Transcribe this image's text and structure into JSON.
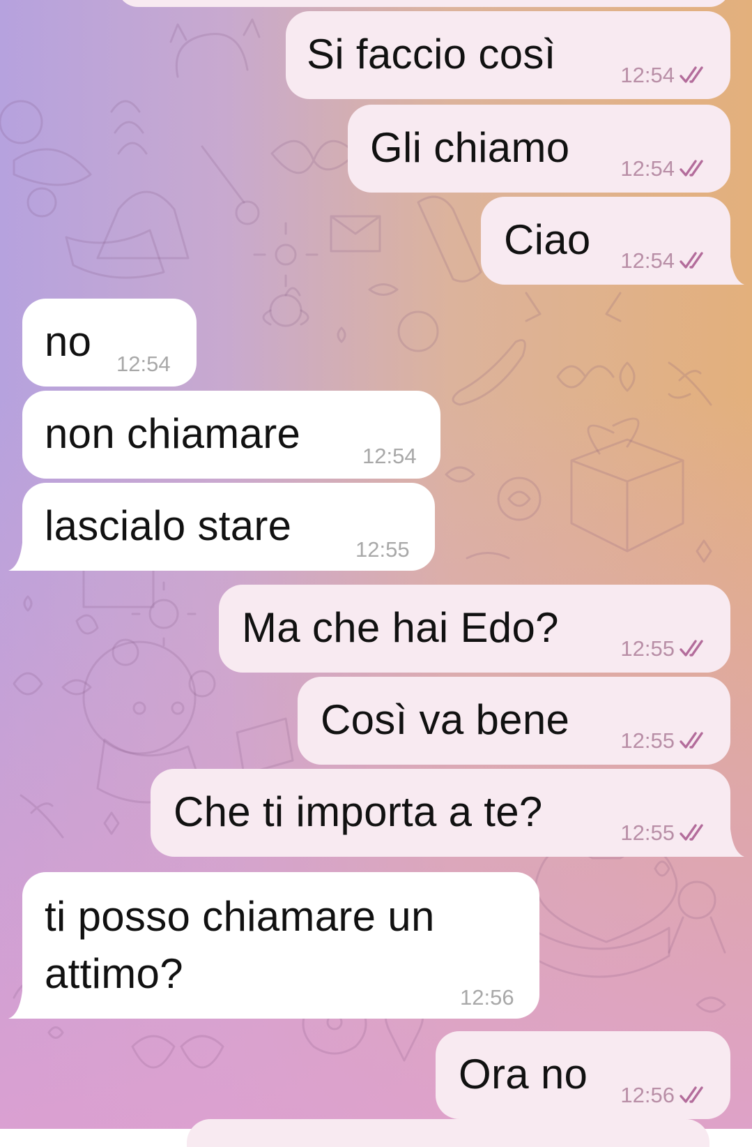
{
  "chat": {
    "messages": [
      {
        "id": "m1",
        "direction": "outgoing",
        "text": "Si faccio così",
        "time": "12:54",
        "status": "read"
      },
      {
        "id": "m2",
        "direction": "outgoing",
        "text": "Gli chiamo",
        "time": "12:54",
        "status": "read"
      },
      {
        "id": "m3",
        "direction": "outgoing",
        "text": "Ciao",
        "time": "12:54",
        "status": "read"
      },
      {
        "id": "m4",
        "direction": "incoming",
        "text": "no",
        "time": "12:54"
      },
      {
        "id": "m5",
        "direction": "incoming",
        "text": "non chiamare",
        "time": "12:54"
      },
      {
        "id": "m6",
        "direction": "incoming",
        "text": "lascialo stare",
        "time": "12:55"
      },
      {
        "id": "m7",
        "direction": "outgoing",
        "text": "Ma che hai Edo?",
        "time": "12:55",
        "status": "read"
      },
      {
        "id": "m8",
        "direction": "outgoing",
        "text": "Così va bene",
        "time": "12:55",
        "status": "read"
      },
      {
        "id": "m9",
        "direction": "outgoing",
        "text": "Che ti importa a te?",
        "time": "12:55",
        "status": "read"
      },
      {
        "id": "m10",
        "direction": "incoming",
        "text_line1": "ti posso chiamare un",
        "text_line2": "attimo?",
        "time": "12:56"
      },
      {
        "id": "m11",
        "direction": "outgoing",
        "text": "Ora no",
        "time": "12:56",
        "status": "read"
      }
    ]
  },
  "icons": {
    "read_receipt": "double-check-icon",
    "background": "doodle-pattern"
  },
  "colors": {
    "outgoing_bubble": "#f8eaf1",
    "incoming_bubble": "#ffffff",
    "read_ticks": "#b36c9b",
    "outgoing_time": "#b88ea6",
    "incoming_time": "#a8a8a8",
    "bg_gradient_left": "#b6a2de",
    "bg_gradient_right": "#e3b07c",
    "bg_gradient_bottom": "#dea0d0"
  }
}
